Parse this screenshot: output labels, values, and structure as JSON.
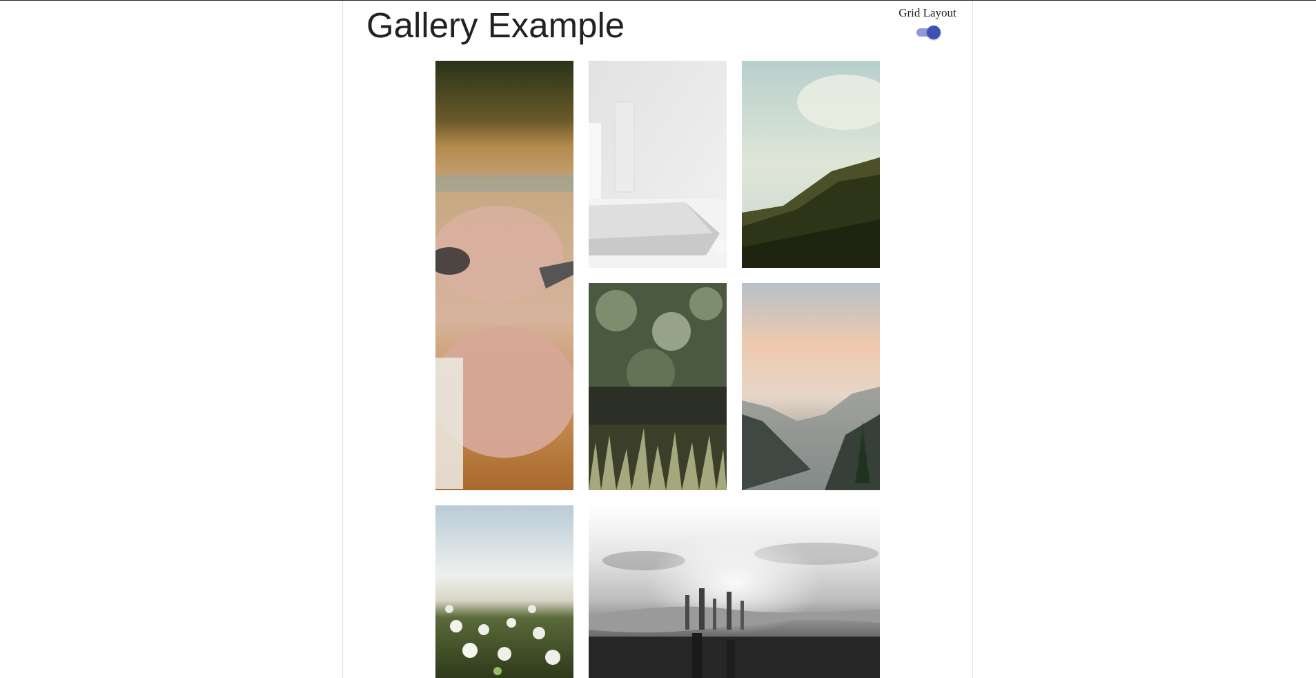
{
  "header": {
    "title": "Gallery Example",
    "layout_toggle_label": "Grid Layout",
    "layout_toggle_on": true
  },
  "colors": {
    "accent": "#3f51b5",
    "accent_track": "#8e99d6"
  },
  "gallery": {
    "images": [
      {
        "subject": "hands writing on wooden desk"
      },
      {
        "subject": "laptop on white desk"
      },
      {
        "subject": "green hillside under sky"
      },
      {
        "subject": "grass with blurred trees"
      },
      {
        "subject": "mountain valley at sunset"
      },
      {
        "subject": "dandelion field"
      },
      {
        "subject": "black and white city aerial view"
      }
    ]
  }
}
